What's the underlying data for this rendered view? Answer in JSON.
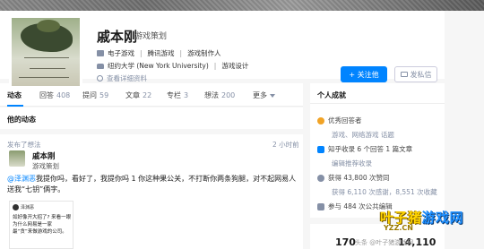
{
  "profile": {
    "name": "戚本刚",
    "headline": "游戏策划",
    "row1": [
      "电子游戏",
      "腾讯游戏",
      "游戏制作人"
    ],
    "row2": [
      "纽约大学 (New York University)",
      "游戏设计"
    ],
    "detail_link": "查看详细资料"
  },
  "actions": {
    "follow": "+ 关注他",
    "message": "发私信"
  },
  "tabs": [
    {
      "label": "动态",
      "count": ""
    },
    {
      "label": "回答",
      "count": "408"
    },
    {
      "label": "提问",
      "count": "59"
    },
    {
      "label": "文章",
      "count": "22"
    },
    {
      "label": "专栏",
      "count": "3"
    },
    {
      "label": "想法",
      "count": "200"
    },
    {
      "label": "更多",
      "count": ""
    }
  ],
  "feed": {
    "title": "他的动态",
    "activity_label": "发布了想法",
    "activity_time": "2 小时前",
    "author_name": "戚本刚",
    "author_headline": "游戏策划",
    "post_mention": "@泽渊恶",
    "post_text": "我提你吗，看好了，我提你吗 1 你这种果公关，不打断你两条狗腿，对不起网易人送我“七钥”俩字。",
    "thumb_name": "泽渊恶",
    "thumb_text": "如好像开大招了? 来看一眼为什么网易是一家最“贪”来做游戏的公司。"
  },
  "side": {
    "title": "个人成就",
    "badge": "优秀回答者",
    "badge_sub": "游戏、网络游戏 话题",
    "collected": "知乎收录 6 个回答 1 篇文章",
    "collected_sub": "编辑推荐收录",
    "likes": "获得 43,800 次赞同",
    "likes_sub": "获得 6,110 次感谢，8,551 次收藏",
    "events": "参与 484 次公共编辑"
  },
  "stats": {
    "following": "170",
    "followers": "14,110"
  },
  "watermark": {
    "brand_a": "叶子猪",
    "brand_b": "游戏网",
    "url": "YZZ.CN",
    "credit": "头条 @叶子猪游戏网"
  }
}
